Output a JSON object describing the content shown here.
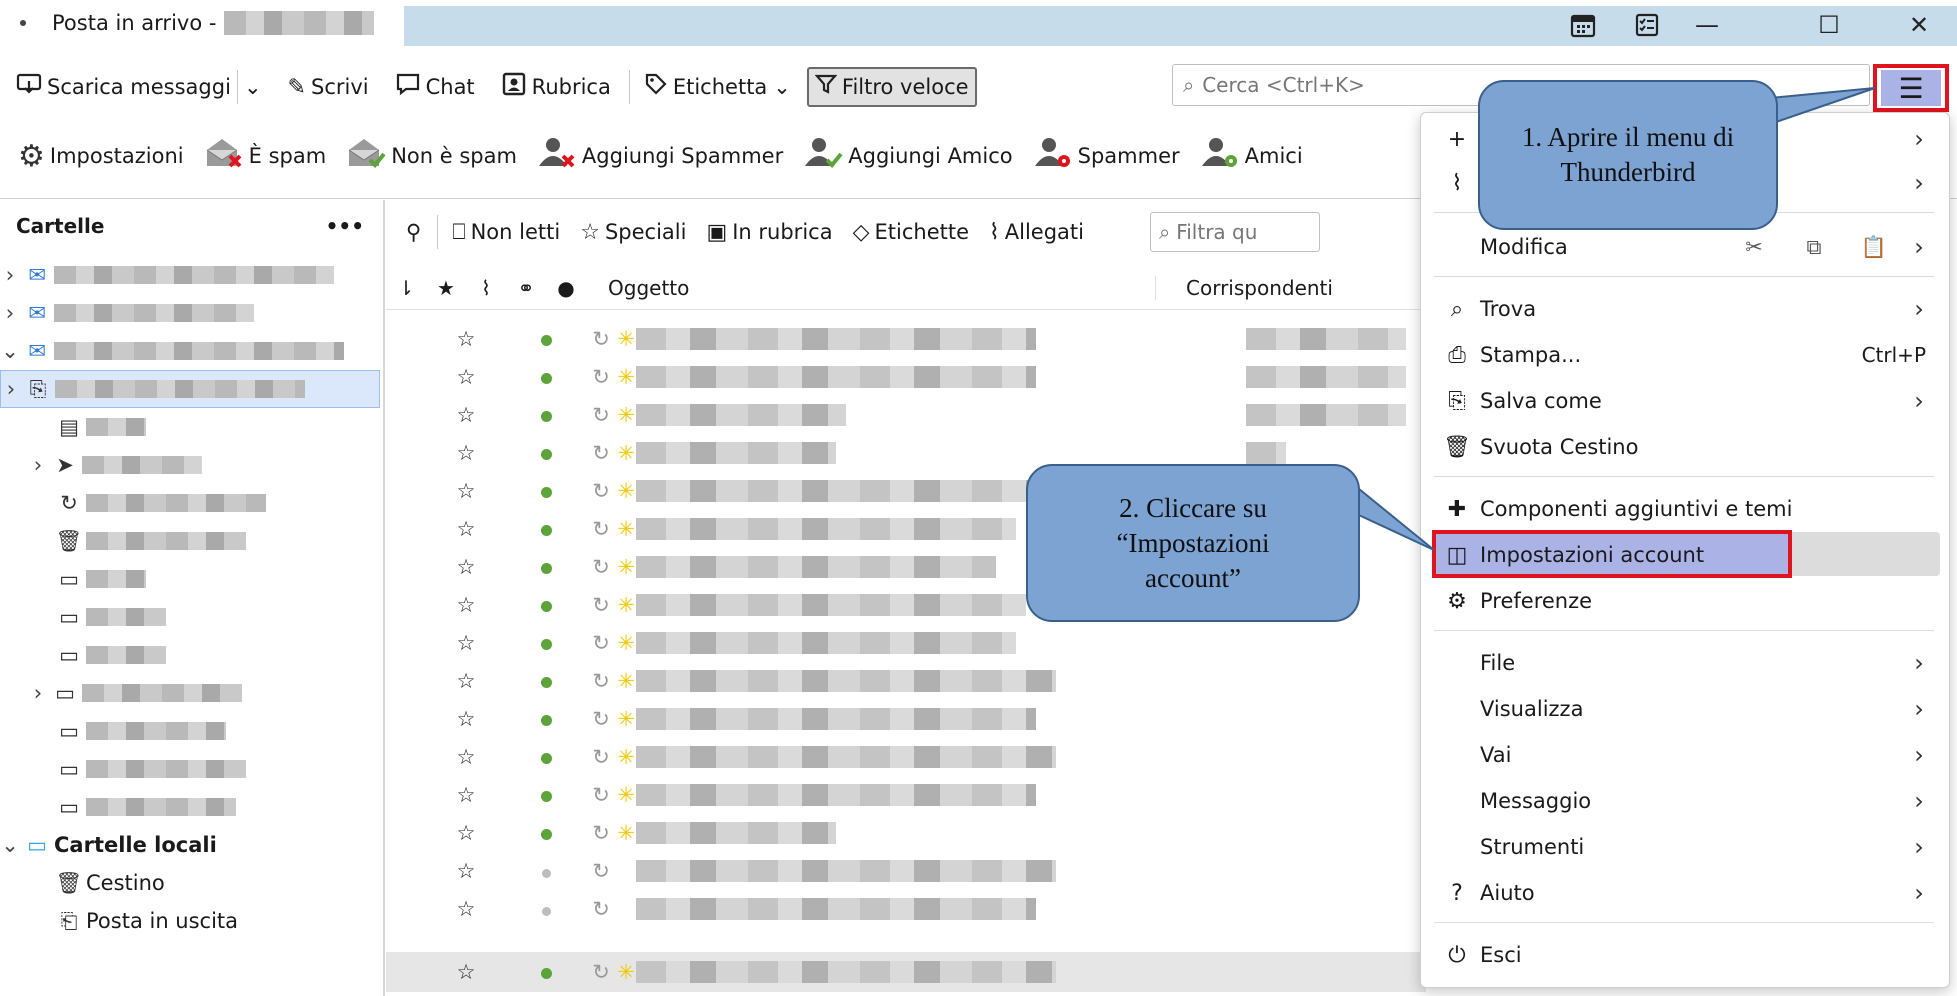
{
  "title_bar": {
    "tab_title": "Posta in arrivo -",
    "calendar_icon": "calendar-icon",
    "tasks_icon": "tasks-icon",
    "minimize": "—",
    "maximize": "☐",
    "close": "✕"
  },
  "toolbar": {
    "get_messages": "Scarica messaggi",
    "write": "Scrivi",
    "chat": "Chat",
    "address_book": "Rubrica",
    "tag": "Etichetta",
    "quick_filter": "Filtro veloce",
    "search_placeholder": "Cerca <Ctrl+K>"
  },
  "toolbar2": {
    "settings": "Impostazioni",
    "is_spam": "È spam",
    "not_spam": "Non è spam",
    "add_spammer": "Aggiungi Spammer",
    "add_friend": "Aggiungi Amico",
    "spammer": "Spammer",
    "friends": "Amici"
  },
  "folders": {
    "header": "Cartelle",
    "more": "•••",
    "local_folders": "Cartelle locali",
    "trash": "Cestino",
    "outbox": "Posta in uscita"
  },
  "filter_bar": {
    "unread": "Non letti",
    "starred": "Speciali",
    "contacts": "In rubrica",
    "tags": "Etichette",
    "attachments": "Allegati",
    "filter_placeholder": "Filtra qu"
  },
  "columns": {
    "subject": "Oggetto",
    "correspondents": "Corrispondenti"
  },
  "app_menu": {
    "edit": "Modifica",
    "find": "Trova",
    "print": "Stampa...",
    "print_shortcut": "Ctrl+P",
    "save_as": "Salva come",
    "empty_trash": "Svuota Cestino",
    "addons": "Componenti aggiuntivi e temi",
    "account_settings": "Impostazioni account",
    "preferences": "Preferenze",
    "file": "File",
    "view": "Visualizza",
    "go": "Vai",
    "message": "Messaggio",
    "tools": "Strumenti",
    "help": "Aiuto",
    "exit": "Esci"
  },
  "callouts": {
    "step1_line1": "1. Aprire il menu di",
    "step1_line2": "Thunderbird",
    "step2_line1": "2. Cliccare su",
    "step2_line2": "“Impostazioni",
    "step2_line3": "account”"
  },
  "colors": {
    "highlight_red": "#e0141e",
    "callout_blue": "#7da3d3",
    "menu_highlight": "#aab2e6"
  }
}
